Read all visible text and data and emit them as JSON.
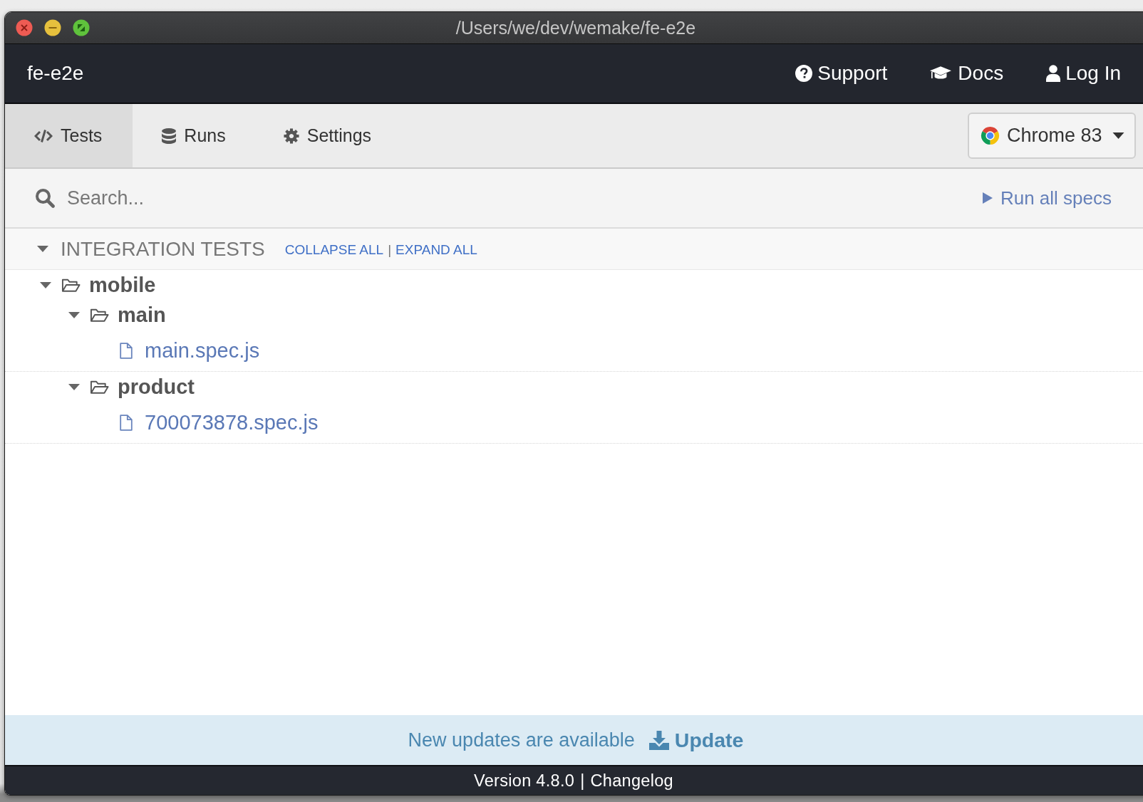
{
  "window": {
    "title": "/Users/we/dev/wemake/fe-e2e"
  },
  "header": {
    "project": "fe-e2e",
    "links": [
      {
        "kind": "support",
        "label": "Support"
      },
      {
        "kind": "docs",
        "label": "Docs"
      },
      {
        "kind": "login",
        "label": "Log In"
      }
    ]
  },
  "tabs": [
    {
      "kind": "tests",
      "label": "Tests",
      "selected": true
    },
    {
      "kind": "runs",
      "label": "Runs",
      "selected": false
    },
    {
      "kind": "settings",
      "label": "Settings",
      "selected": false
    }
  ],
  "browser": {
    "label": "Chrome 83"
  },
  "search": {
    "placeholder": "Search..."
  },
  "run_all": {
    "label": "Run all specs"
  },
  "section": {
    "title": "INTEGRATION TESTS",
    "expanded": true,
    "actions": [
      "COLLAPSE ALL",
      "EXPAND ALL"
    ],
    "separator": "|"
  },
  "tree": [
    {
      "kind": "folder",
      "name": "mobile",
      "expanded": true,
      "children": [
        {
          "kind": "folder",
          "name": "main",
          "expanded": true,
          "children": [
            {
              "kind": "file",
              "name": "main.spec.js"
            }
          ]
        },
        {
          "kind": "folder",
          "name": "product",
          "expanded": true,
          "children": [
            {
              "kind": "file",
              "name": "700073878.spec.js"
            }
          ]
        }
      ]
    }
  ],
  "update_banner": {
    "message": "New updates are available",
    "button": "Update"
  },
  "footer": {
    "version": "Version 4.8.0",
    "separator": "|",
    "link": "Changelog"
  }
}
